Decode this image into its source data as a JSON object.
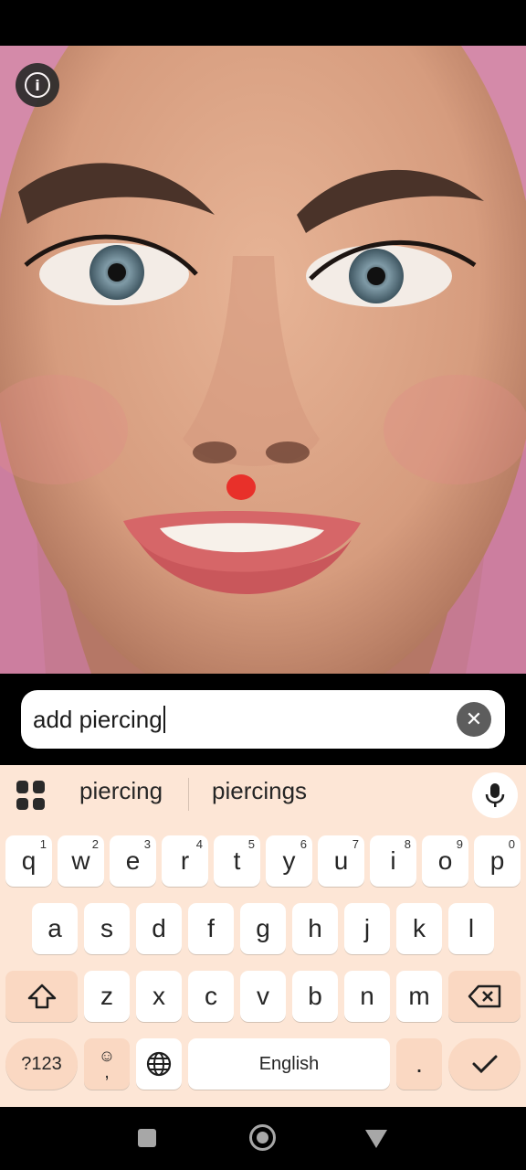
{
  "app": {
    "info_icon": "info-icon",
    "mask_color": "#e8302a"
  },
  "prompt": {
    "value": "add piercing",
    "clear_icon": "close-icon"
  },
  "suggestions": {
    "apps_icon": "grid-icon",
    "items": [
      "piercing",
      "piercings"
    ],
    "mic_icon": "microphone-icon"
  },
  "keyboard": {
    "row1": [
      {
        "label": "q",
        "hint": "1"
      },
      {
        "label": "w",
        "hint": "2"
      },
      {
        "label": "e",
        "hint": "3"
      },
      {
        "label": "r",
        "hint": "4"
      },
      {
        "label": "t",
        "hint": "5"
      },
      {
        "label": "y",
        "hint": "6"
      },
      {
        "label": "u",
        "hint": "7"
      },
      {
        "label": "i",
        "hint": "8"
      },
      {
        "label": "o",
        "hint": "9"
      },
      {
        "label": "p",
        "hint": "0"
      }
    ],
    "row2": [
      "a",
      "s",
      "d",
      "f",
      "g",
      "h",
      "j",
      "k",
      "l"
    ],
    "row3": [
      "z",
      "x",
      "c",
      "v",
      "b",
      "n",
      "m"
    ],
    "shift_icon": "shift-icon",
    "backspace_icon": "backspace-icon",
    "symbols_label": "?123",
    "emoji_top": "☺",
    "emoji_bottom": ",",
    "globe_icon": "globe-icon",
    "space_label": "English",
    "period_label": ".",
    "enter_icon": "check-icon"
  },
  "navigation": {
    "recents_icon": "square-icon",
    "home_icon": "home-circle-icon",
    "back_icon": "back-triangle-icon"
  }
}
